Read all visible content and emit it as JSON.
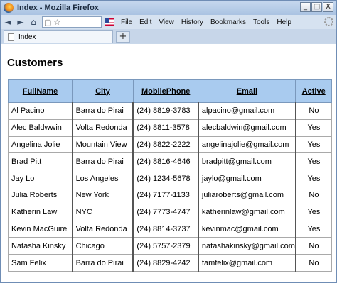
{
  "window": {
    "title": "Index - Mozilla Firefox",
    "minimize": "_",
    "maximize": "□",
    "close": "X"
  },
  "toolbar": {
    "back": "◄",
    "forward": "►",
    "home": "⌂",
    "bookmark_star": "☆",
    "menu": [
      "File",
      "Edit",
      "View",
      "History",
      "Bookmarks",
      "Tools",
      "Help"
    ]
  },
  "tabs": [
    {
      "label": "Index"
    }
  ],
  "new_tab": "+",
  "page": {
    "heading": "Customers",
    "columns": [
      "FullName",
      "City",
      "MobilePhone",
      "Email",
      "Active"
    ],
    "rows": [
      {
        "name": "Al Pacino",
        "city": "Barra do Pirai",
        "phone": "(24) 8819-3783",
        "email": "alpacino@gmail.com",
        "active": "No"
      },
      {
        "name": "Alec Baldwwin",
        "city": "Volta Redonda",
        "phone": "(24) 8811-3578",
        "email": "alecbaldwin@gmail.com",
        "active": "Yes"
      },
      {
        "name": "Angelina Jolie",
        "city": "Mountain View",
        "phone": "(24) 8822-2222",
        "email": "angelinajolie@gmail.com",
        "active": "Yes"
      },
      {
        "name": "Brad Pitt",
        "city": "Barra do Pirai",
        "phone": "(24) 8816-4646",
        "email": "bradpitt@gmail.com",
        "active": "Yes"
      },
      {
        "name": "Jay Lo",
        "city": "Los Angeles",
        "phone": "(24) 1234-5678",
        "email": "jaylo@gmail.com",
        "active": "Yes"
      },
      {
        "name": "Julia Roberts",
        "city": "New York",
        "phone": "(24) 7177-1133",
        "email": "juliaroberts@gmail.com",
        "active": "No"
      },
      {
        "name": "Katherin Law",
        "city": "NYC",
        "phone": "(24) 7773-4747",
        "email": "katherinlaw@gmail.com",
        "active": "Yes"
      },
      {
        "name": "Kevin MacGuire",
        "city": "Volta Redonda",
        "phone": "(24) 8814-3737",
        "email": "kevinmac@gmail.com",
        "active": "Yes"
      },
      {
        "name": "Natasha Kinsky",
        "city": "Chicago",
        "phone": "(24) 5757-2379",
        "email": "natashakinsky@gmail.com",
        "active": "No"
      },
      {
        "name": "Sam Felix",
        "city": "Barra do Pirai",
        "phone": "(24) 8829-4242",
        "email": "famfelix@gmail.com",
        "active": "No"
      }
    ]
  }
}
